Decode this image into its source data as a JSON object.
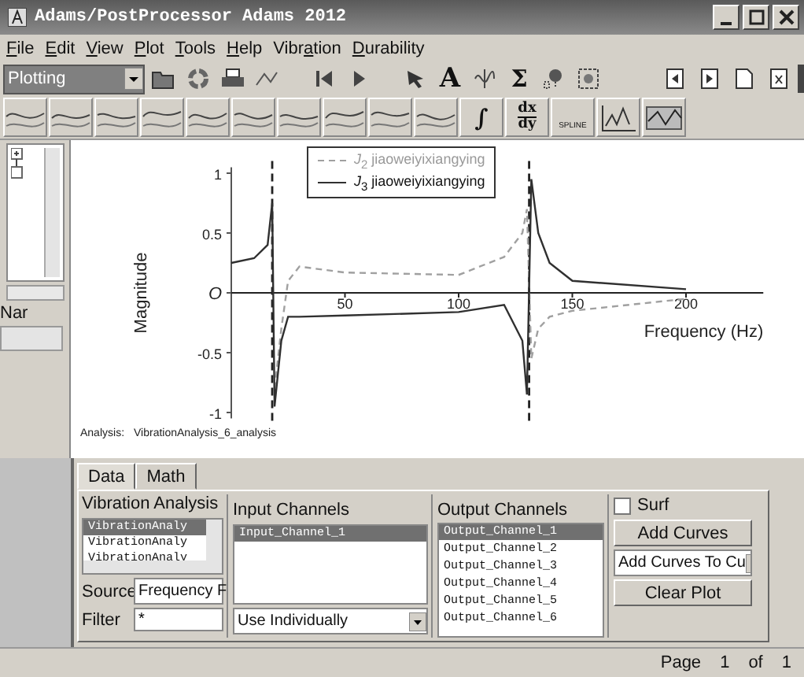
{
  "window": {
    "title": "Adams/PostProcessor Adams 2012"
  },
  "menu": [
    {
      "label": "File"
    },
    {
      "label": "Edit"
    },
    {
      "label": "View"
    },
    {
      "label": "Plot"
    },
    {
      "label": "Tools"
    },
    {
      "label": "Help"
    },
    {
      "label": "Vibration"
    },
    {
      "label": "Durability"
    }
  ],
  "toolbar": {
    "mode": "Plotting",
    "text_button": "A",
    "sum_button": "Σ"
  },
  "curve_toolbar": {
    "integrate_button": "∫",
    "derivative_top": "dx",
    "derivative_bottom": "dy",
    "spline_label": "SPLINE"
  },
  "tree": {
    "name_label": "Nar"
  },
  "plot": {
    "analysis_label": "Analysis:",
    "analysis_name": "VibrationAnalysis_6_analysis",
    "chart_data": {
      "type": "line",
      "xlabel": "Frequency (Hz)",
      "ylabel": "Magnitude",
      "x": [
        0,
        10,
        16,
        18,
        19,
        22,
        25,
        30,
        50,
        100,
        120,
        128,
        130,
        132,
        135,
        140,
        150,
        200
      ],
      "series": [
        {
          "name": "*J*$_{2}$  jiaoweiyixiangying",
          "color": "#a0a0a0",
          "line_style": "dashed",
          "values": [
            null,
            null,
            null,
            null,
            -0.8,
            -0.3,
            0.1,
            0.22,
            0.17,
            0.15,
            0.3,
            0.5,
            0.7,
            -0.55,
            -0.3,
            -0.2,
            -0.15,
            -0.05
          ]
        },
        {
          "name": "*J*$_{3}$  jiaoweiyixiangying",
          "color": "#303030",
          "line_style": "solid",
          "values": [
            0.25,
            0.29,
            0.4,
            0.75,
            -0.95,
            -0.4,
            -0.2,
            -0.2,
            -0.19,
            -0.16,
            -0.1,
            -0.4,
            -0.85,
            0.95,
            0.5,
            0.25,
            0.1,
            0.03
          ]
        }
      ],
      "xlim": [
        0,
        234
      ],
      "ylim": [
        -1.05,
        1.05
      ],
      "xticks": [
        50,
        100,
        150,
        200
      ],
      "yticks": [
        {
          "value": -1,
          "label": "-1"
        },
        {
          "value": -0.5,
          "label": "-0.5"
        },
        {
          "value": 0,
          "label": "O"
        },
        {
          "value": 0.5,
          "label": "0.5"
        },
        {
          "value": 1,
          "label": "1"
        }
      ],
      "ref_lines": [
        {
          "axis": "x",
          "value": 18
        },
        {
          "axis": "x",
          "value": 131
        }
      ]
    }
  },
  "tabs": [
    {
      "label": "Data",
      "selected": true
    },
    {
      "label": "Math",
      "selected": false
    }
  ],
  "analysis_list": {
    "heading": "Vibration Analysis",
    "items": [
      {
        "label": "VibrationAnaly",
        "selected": true
      },
      {
        "label": "VibrationAnaly",
        "selected": false
      },
      {
        "label": "VibrationAnaly",
        "selected": false
      }
    ]
  },
  "source": {
    "label": "Source",
    "value": "Frequency F"
  },
  "filter": {
    "label": "Filter",
    "value": "*"
  },
  "input_channels": {
    "heading": "Input Channels",
    "items": [
      {
        "label": "Input_Channel_1",
        "selected": true
      }
    ],
    "mode": "Use Individually"
  },
  "output_channels": {
    "heading": "Output Channels",
    "items": [
      {
        "label": "Output_Channel_1",
        "selected": true
      },
      {
        "label": "Output_Channel_2",
        "selected": false
      },
      {
        "label": "Output_Channel_3",
        "selected": false
      },
      {
        "label": "Output_Channel_4",
        "selected": false
      },
      {
        "label": "Output_Channel_5",
        "selected": false
      },
      {
        "label": "Output_Channel_6",
        "selected": false
      }
    ]
  },
  "surf": {
    "label": "Surf",
    "checked": false
  },
  "buttons": {
    "add": "Add Curves",
    "add_to": "Add Curves To Cu",
    "clear": "Clear Plot"
  },
  "status_bar": {
    "page_label": "Page",
    "page": "1",
    "of": "of",
    "total": "1"
  }
}
